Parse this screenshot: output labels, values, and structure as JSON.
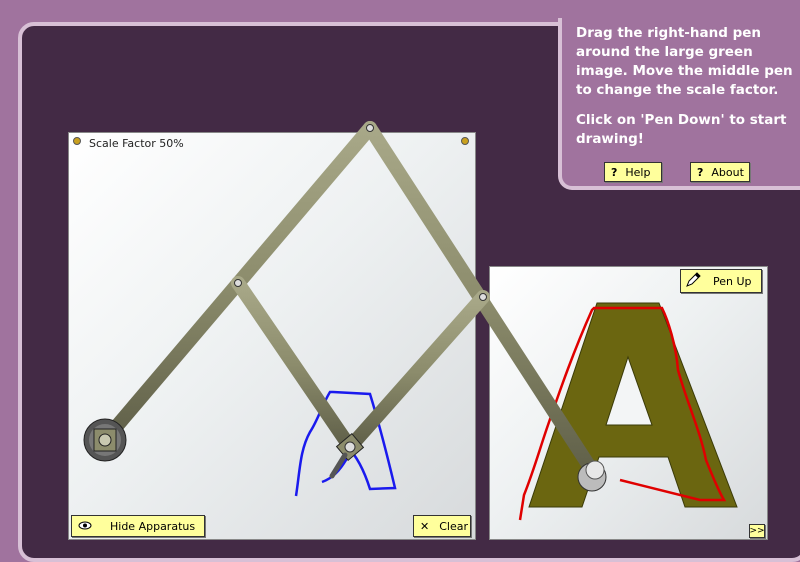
{
  "instructions": {
    "line1": "Drag the right-hand pen around the large green image. Move the middle pen to change the scale factor.",
    "line2": "Click on 'Pen Down' to start drawing!"
  },
  "buttons": {
    "help": "Help",
    "about": "About",
    "hide_apparatus": "Hide Apparatus",
    "clear": "Clear",
    "pen_up": "Pen Up",
    "expand": ">>",
    "question_mark": "?",
    "clear_icon": "✕"
  },
  "drawing_panel": {
    "scale_label": "Scale Factor 50%"
  },
  "target_panel": {
    "letter": "A"
  },
  "colors": {
    "page_bg": "#a0739e",
    "frame_bg": "#432a45",
    "arm": "#8c8c6c",
    "target_fill": "#6b6610",
    "trace_red": "#e00000",
    "trace_blue": "#1a1aee",
    "button": "#ffff9c"
  },
  "icons": [
    "eye-icon",
    "close-icon",
    "pencil-icon",
    "help-icon",
    "pivot-icon",
    "pen-icon"
  ]
}
